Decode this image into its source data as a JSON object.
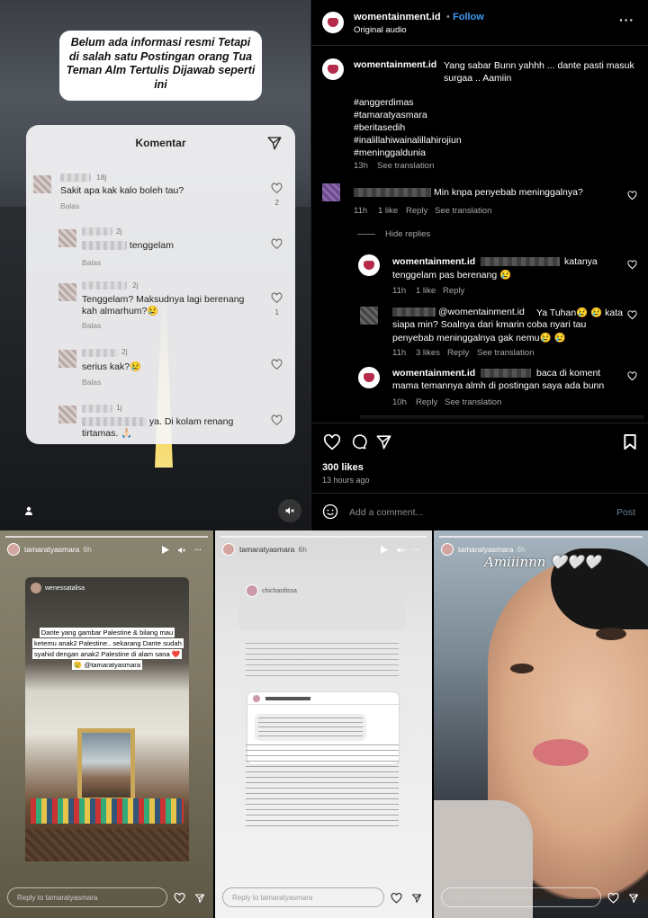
{
  "reel": {
    "caption": "Belum ada informasi resmi Tetapi di salah satu Postingan orang Tua Teman Alm Tertulis Dijawab seperti ini",
    "comments_title": "Komentar",
    "comments": [
      {
        "time": "18j",
        "text": "Sakit apa kak kalo boleh tau?",
        "reply": "Balas",
        "likes": "2"
      },
      {
        "time": "2j",
        "text": "tenggelam",
        "reply": "Balas",
        "likes": ""
      },
      {
        "time": "2j",
        "text": "Tenggelam? Maksudnya lagi berenang kah almarhum?😢",
        "reply": "Balas",
        "likes": "1"
      },
      {
        "time": "2j",
        "text": "serius kak?😢",
        "reply": "Balas",
        "likes": ""
      },
      {
        "time": "1j",
        "text": "ya. Di kolam renang tirtamas. 🙏🏻",
        "reply": "",
        "likes": ""
      }
    ]
  },
  "post": {
    "account": "womentainment.id",
    "follow_label": "Follow",
    "audio": "Original audio",
    "caption_text": "Yang sabar Bunn yahhh ... dante pasti masuk surgaa .. Aamiin",
    "hashtags": [
      "#anggerdimas",
      "#tamaratyasmara",
      "#beritasedih",
      "#inalillahiwainalillahirojiun",
      "#meninggaldunia"
    ],
    "caption_meta": {
      "time": "13h",
      "see": "See translation"
    },
    "comments": [
      {
        "text": "Min knpa penyebab meninggalnya?",
        "time": "11h",
        "likes": "1 like",
        "reply": "Reply",
        "see": "See translation"
      },
      {
        "author": "womentainment.id",
        "text1": "katanya",
        "text2": "tenggelam pas berenang 😢",
        "time": "11h",
        "likes": "1 like",
        "reply": "Reply"
      },
      {
        "mention": "@womentainment.id",
        "text1": "Ya Tuhan😢 😢 kata",
        "text2": "siapa min? Soalnya dari kmarin coba nyari tau",
        "text3": "penyebab meninggalnya gak nemu😢 😢",
        "time": "11h",
        "likes": "3 likes",
        "reply": "Reply",
        "see": "See translation"
      },
      {
        "author": "womentainment.id",
        "text1": "baca di koment",
        "text2": "mama temannya almh di postingan saya ada bunn",
        "time": "10h",
        "reply": "Reply",
        "see": "See translation"
      }
    ],
    "hide_replies": "Hide replies",
    "likes": "300 likes",
    "time_ago": "13 hours ago",
    "add_comment_placeholder": "Add a comment...",
    "post_label": "Post"
  },
  "stories": [
    {
      "user": "tamaratyasmara",
      "time": "6h",
      "shared_user": "wenessatalisa",
      "text": "Dante yang gambar Palestine & bilang mau ketemu anak2 Palestine.. sekarang Dante sudah syahid dengan anak2 Palestine di alam sana ❤️😢 @tamaratyasmara",
      "reply_placeholder": "Reply to tamaratyasmara"
    },
    {
      "user": "tamaratyasmara",
      "time": "6h",
      "shared_user": "chichardissa",
      "reply_placeholder": "Reply to tamaratyasmara"
    },
    {
      "user": "tamaratyasmara",
      "time": "6h",
      "overlay": "Amiiinnn 🤍🤍🤍",
      "reply_placeholder": "Reply to tamaratyasmara"
    }
  ]
}
